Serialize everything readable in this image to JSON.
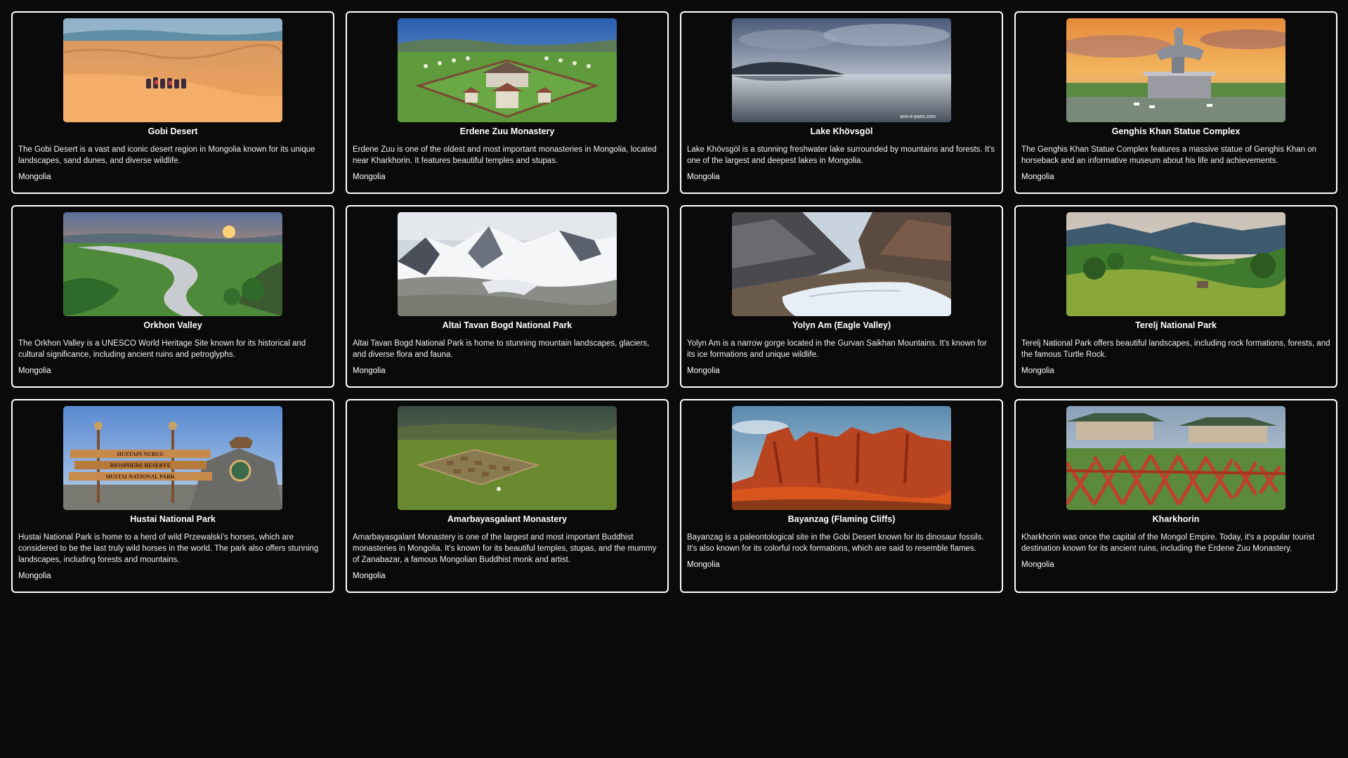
{
  "cards": [
    {
      "title": "Gobi Desert",
      "description": "The Gobi Desert is a vast and iconic desert region in Mongolia known for its unique landscapes, sand dunes, and diverse wildlife.",
      "country": "Mongolia"
    },
    {
      "title": "Erdene Zuu Monastery",
      "description": "Erdene Zuu is one of the oldest and most important monasteries in Mongolia, located near Kharkhorin. It features beautiful temples and stupas.",
      "country": "Mongolia"
    },
    {
      "title": "Lake Khövsgöl",
      "description": "Lake Khövsgöl is a stunning freshwater lake surrounded by mountains and forests. It's one of the largest and deepest lakes in Mongolia.",
      "country": "Mongolia",
      "watermark": "ann-e-paris.com"
    },
    {
      "title": "Genghis Khan Statue Complex",
      "description": "The Genghis Khan Statue Complex features a massive statue of Genghis Khan on horseback and an informative museum about his life and achievements.",
      "country": "Mongolia"
    },
    {
      "title": "Orkhon Valley",
      "description": "The Orkhon Valley is a UNESCO World Heritage Site known for its historical and cultural significance, including ancient ruins and petroglyphs.",
      "country": "Mongolia"
    },
    {
      "title": "Altai Tavan Bogd National Park",
      "description": "Altai Tavan Bogd National Park is home to stunning mountain landscapes, glaciers, and diverse flora and fauna.",
      "country": "Mongolia"
    },
    {
      "title": "Yolyn Am (Eagle Valley)",
      "description": "Yolyn Am is a narrow gorge located in the Gurvan Saikhan Mountains. It's known for its ice formations and unique wildlife.",
      "country": "Mongolia"
    },
    {
      "title": "Terelj National Park",
      "description": "Terelj National Park offers beautiful landscapes, including rock formations, forests, and the famous Turtle Rock.",
      "country": "Mongolia"
    },
    {
      "title": "Hustai National Park",
      "description": "Hustai National Park is home to a herd of wild Przewalski's horses, which are considered to be the last truly wild horses in the world. The park also offers stunning landscapes, including forests and mountains.",
      "country": "Mongolia",
      "sign_lines": [
        "HUSTAIN NURUU",
        "BIOSPHERE RESERVE",
        "HUSTAI NATIONAL PARK"
      ]
    },
    {
      "title": "Amarbayasgalant Monastery",
      "description": "Amarbayasgalant Monastery is one of the largest and most important Buddhist monasteries in Mongolia. It's known for its beautiful temples, stupas, and the mummy of Zanabazar, a famous Mongolian Buddhist monk and artist.",
      "country": "Mongolia"
    },
    {
      "title": "Bayanzag (Flaming Cliffs)",
      "description": "Bayanzag is a paleontological site in the Gobi Desert known for its dinosaur fossils. It's also known for its colorful rock formations, which are said to resemble flames.",
      "country": "Mongolia"
    },
    {
      "title": "Kharkhorin",
      "description": "Kharkhorin was once the capital of the Mongol Empire. Today, it's a popular tourist destination known for its ancient ruins, including the Erdene Zuu Monastery.",
      "country": "Mongolia"
    }
  ],
  "colors": {
    "page_background": "#0b0b0b",
    "card_border": "#ffffff",
    "text": "#ffffff"
  }
}
